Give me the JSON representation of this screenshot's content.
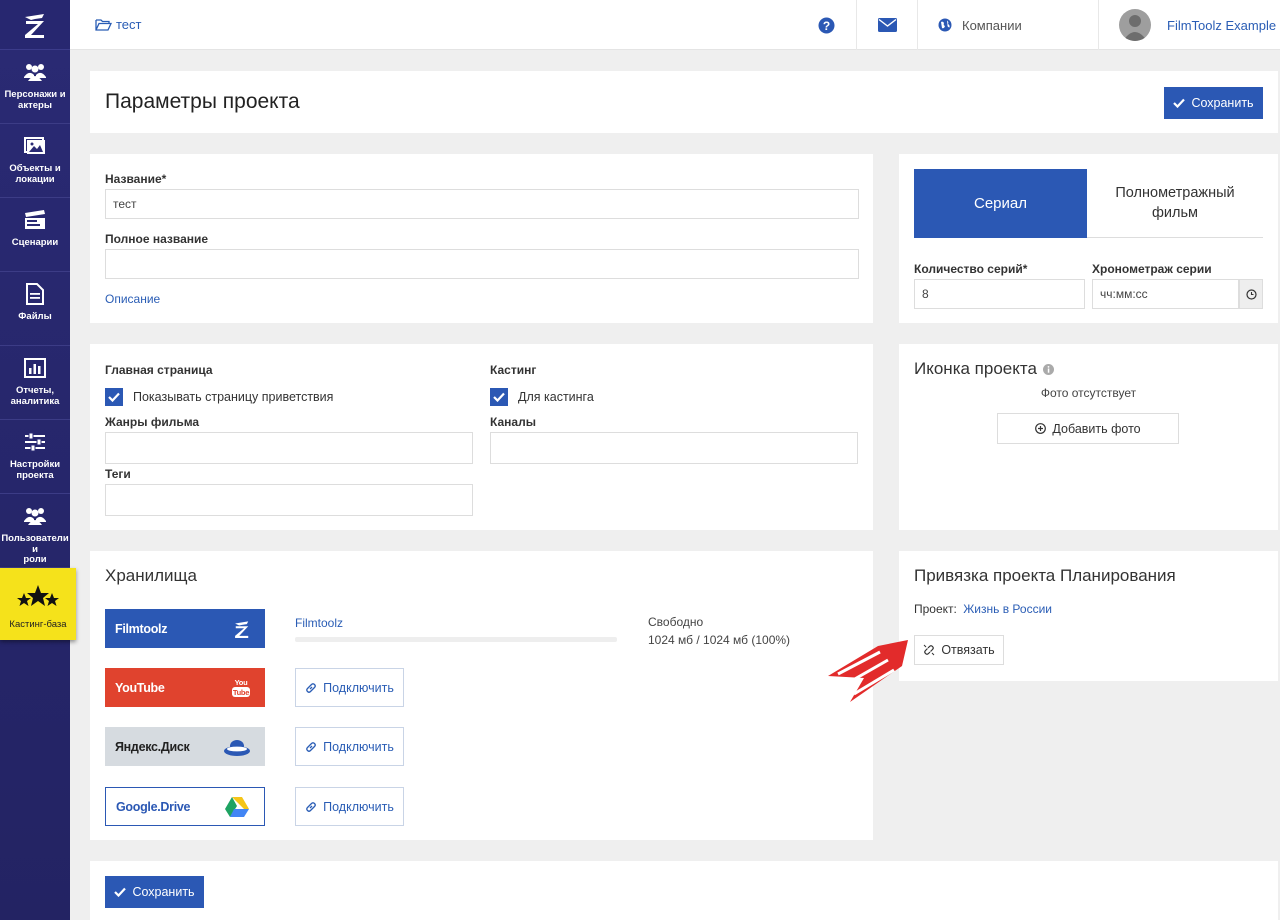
{
  "sidebar": {
    "logo": "Z",
    "items": [
      {
        "label": "Персонажи и\nактеры",
        "icon": "users-icon"
      },
      {
        "label": "Объекты и\nлокации",
        "icon": "image-icon"
      },
      {
        "label": "Сценарии",
        "icon": "clapperboard-icon"
      },
      {
        "label": "Файлы",
        "icon": "file-icon"
      },
      {
        "label": "Отчеты,\nаналитика",
        "icon": "chart-icon"
      },
      {
        "label": "Настройки\nпроекта",
        "icon": "sliders-icon"
      },
      {
        "label": "Пользователи и\nроли",
        "icon": "users-icon"
      },
      {
        "label": "Кастинг-база",
        "icon": "stars-icon"
      }
    ]
  },
  "topbar": {
    "breadcrumb": "тест",
    "companies": "Компании",
    "user": "FilmToolz Example"
  },
  "header": {
    "title": "Параметры проекта",
    "save": "Сохранить"
  },
  "general": {
    "name_label": "Название",
    "name_value": "тест",
    "fullname_label": "Полное название",
    "fullname_value": "",
    "description_link": "Описание",
    "required_mark": "*"
  },
  "type": {
    "tab_series": "Сериал",
    "tab_film": "Полнометражный фильм",
    "count_label": "Количество серий",
    "count_value": "8",
    "duration_label": "Хронометраж серии",
    "duration_placeholder": "чч:мм:сс"
  },
  "settings": {
    "main_page_label": "Главная страница",
    "show_welcome": "Показывать страницу приветствия",
    "genres_label": "Жанры фильма",
    "tags_label": "Теги",
    "casting_label": "Кастинг",
    "for_casting": "Для кастинга",
    "channels_label": "Каналы"
  },
  "icon_panel": {
    "title": "Иконка проекта",
    "no_photo": "Фото отсутствует",
    "add_photo": "Добавить фото"
  },
  "storage": {
    "title": "Хранилища",
    "filmtoolz_name": "Filmtoolz",
    "free_label": "Свободно",
    "free_value": "1024 мб / 1024 мб (100%)",
    "used_fraction": 0,
    "providers": [
      {
        "name": "Filmtoolz",
        "color": "#2b58b4"
      },
      {
        "name": "YouTube",
        "color": "#e0432e"
      },
      {
        "name": "Яндекс.Диск",
        "color": "#d6dbe0"
      },
      {
        "name": "Google.Drive",
        "color": "#ffffff"
      }
    ],
    "connect": "Подключить"
  },
  "planning": {
    "title": "Привязка проекта Планирования",
    "project_label": "Проект:",
    "project_value": "Жизнь в России",
    "unlink": "Отвязать"
  },
  "footer": {
    "save": "Сохранить"
  }
}
